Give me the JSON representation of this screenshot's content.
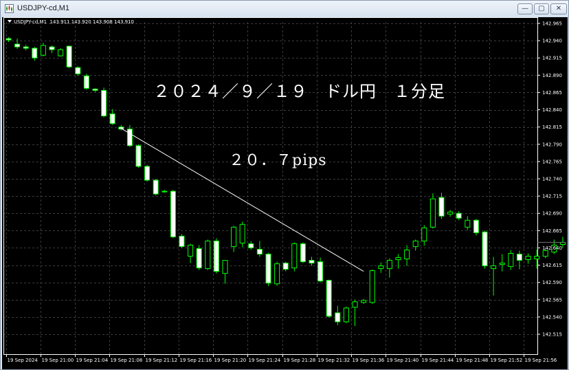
{
  "window": {
    "title": "USDJPY-cd,M1",
    "buttons": {
      "minimize": "—",
      "maximize": "▢",
      "close": "✕"
    }
  },
  "chart_header": {
    "symbol": "USDJPY-cd,M1",
    "ohlc": "143.911 143.920 143.908 143.910"
  },
  "annotations": {
    "title": "２０２４／９／１９　ドル円　１分足",
    "pips": "２０．７pips"
  },
  "colors": {
    "background": "#000000",
    "grid": "#3c3c3c",
    "bull": "#00ff00",
    "bear_body": "#ffffff",
    "bear_wick": "#00ff00",
    "text": "#ffffff",
    "trendline": "#ffffff"
  },
  "chart_data": {
    "type": "candlestick",
    "symbol": "USDJPY-cd",
    "timeframe": "M1",
    "y_axis": {
      "ticks": [
        142.965,
        142.94,
        142.915,
        142.89,
        142.865,
        142.84,
        142.815,
        142.79,
        142.765,
        142.74,
        142.715,
        142.69,
        142.665,
        142.64,
        142.615,
        142.59,
        142.565,
        142.54,
        142.515
      ],
      "tick_labels": [
        "142.965",
        "142.940",
        "142.915",
        "142.890",
        "142.865",
        "142.840",
        "142.815",
        "142.790",
        "142.765",
        "142.740",
        "142.715",
        "142.690",
        "142.665",
        "142.640",
        "142.615",
        "142.590",
        "142.565",
        "142.540",
        "142.515"
      ]
    },
    "x_axis": {
      "labels": [
        "19 Sep 2024",
        "19 Sep 21:00",
        "19 Sep 21:04",
        "19 Sep 21:08",
        "19 Sep 21:12",
        "19 Sep 21:16",
        "19 Sep 21:20",
        "19 Sep 21:24",
        "19 Sep 21:28",
        "19 Sep 21:32",
        "19 Sep 21:36",
        "19 Sep 21:40",
        "19 Sep 21:44",
        "19 Sep 21:48",
        "19 Sep 21:52",
        "19 Sep 21:56"
      ]
    },
    "grid": true,
    "candles": [
      {
        "o": 142.943,
        "h": 142.945,
        "l": 142.938,
        "c": 142.941
      },
      {
        "o": 142.935,
        "h": 142.943,
        "l": 142.928,
        "c": 142.931
      },
      {
        "o": 142.931,
        "h": 142.934,
        "l": 142.926,
        "c": 142.929
      },
      {
        "o": 142.929,
        "h": 142.931,
        "l": 142.911,
        "c": 142.915
      },
      {
        "o": 142.919,
        "h": 142.937,
        "l": 142.917,
        "c": 142.933
      },
      {
        "o": 142.931,
        "h": 142.933,
        "l": 142.922,
        "c": 142.927
      },
      {
        "o": 142.918,
        "h": 142.929,
        "l": 142.917,
        "c": 142.927
      },
      {
        "o": 142.932,
        "h": 142.933,
        "l": 142.9,
        "c": 142.902
      },
      {
        "o": 142.901,
        "h": 142.903,
        "l": 142.889,
        "c": 142.892
      },
      {
        "o": 142.889,
        "h": 142.892,
        "l": 142.869,
        "c": 142.871
      },
      {
        "o": 142.87,
        "h": 142.871,
        "l": 142.866,
        "c": 142.868
      },
      {
        "o": 142.868,
        "h": 142.872,
        "l": 142.829,
        "c": 142.831
      },
      {
        "o": 142.834,
        "h": 142.841,
        "l": 142.818,
        "c": 142.82
      },
      {
        "o": 142.815,
        "h": 142.818,
        "l": 142.81,
        "c": 142.812
      },
      {
        "o": 142.812,
        "h": 142.818,
        "l": 142.786,
        "c": 142.788
      },
      {
        "o": 142.788,
        "h": 142.79,
        "l": 142.756,
        "c": 142.758
      },
      {
        "o": 142.758,
        "h": 142.76,
        "l": 142.736,
        "c": 142.738
      },
      {
        "o": 142.738,
        "h": 142.74,
        "l": 142.716,
        "c": 142.718
      },
      {
        "o": 142.722,
        "h": 142.724,
        "l": 142.72,
        "c": 142.722
      },
      {
        "o": 142.722,
        "h": 142.724,
        "l": 142.654,
        "c": 142.656
      },
      {
        "o": 142.657,
        "h": 142.66,
        "l": 142.64,
        "c": 142.642
      },
      {
        "o": 142.628,
        "h": 142.646,
        "l": 142.618,
        "c": 142.644
      },
      {
        "o": 142.639,
        "h": 142.644,
        "l": 142.608,
        "c": 142.611
      },
      {
        "o": 142.61,
        "h": 142.652,
        "l": 142.608,
        "c": 142.65
      },
      {
        "o": 142.65,
        "h": 142.654,
        "l": 142.603,
        "c": 142.606
      },
      {
        "o": 142.603,
        "h": 142.62,
        "l": 142.588,
        "c": 142.622
      },
      {
        "o": 142.642,
        "h": 142.672,
        "l": 142.634,
        "c": 142.67
      },
      {
        "o": 142.647,
        "h": 142.678,
        "l": 142.641,
        "c": 142.674
      },
      {
        "o": 142.646,
        "h": 142.65,
        "l": 142.637,
        "c": 142.64
      },
      {
        "o": 142.638,
        "h": 142.65,
        "l": 142.627,
        "c": 142.631
      },
      {
        "o": 142.631,
        "h": 142.633,
        "l": 142.585,
        "c": 142.589
      },
      {
        "o": 142.588,
        "h": 142.62,
        "l": 142.585,
        "c": 142.617
      },
      {
        "o": 142.618,
        "h": 142.62,
        "l": 142.606,
        "c": 142.609
      },
      {
        "o": 142.611,
        "h": 142.648,
        "l": 142.606,
        "c": 142.646
      },
      {
        "o": 142.646,
        "h": 142.648,
        "l": 142.618,
        "c": 142.62
      },
      {
        "o": 142.622,
        "h": 142.627,
        "l": 142.614,
        "c": 142.618
      },
      {
        "o": 142.62,
        "h": 142.626,
        "l": 142.59,
        "c": 142.592
      },
      {
        "o": 142.593,
        "h": 142.594,
        "l": 142.539,
        "c": 142.541
      },
      {
        "o": 142.546,
        "h": 142.556,
        "l": 142.528,
        "c": 142.533
      },
      {
        "o": 142.533,
        "h": 142.555,
        "l": 142.531,
        "c": 142.553
      },
      {
        "o": 142.554,
        "h": 142.565,
        "l": 142.527,
        "c": 142.562
      },
      {
        "o": 142.561,
        "h": 142.566,
        "l": 142.559,
        "c": 142.564
      },
      {
        "o": 142.561,
        "h": 142.609,
        "l": 142.559,
        "c": 142.607
      },
      {
        "o": 142.61,
        "h": 142.619,
        "l": 142.604,
        "c": 142.614
      },
      {
        "o": 142.61,
        "h": 142.625,
        "l": 142.597,
        "c": 142.622
      },
      {
        "o": 142.623,
        "h": 142.631,
        "l": 142.61,
        "c": 142.626
      },
      {
        "o": 142.624,
        "h": 142.644,
        "l": 142.614,
        "c": 142.637
      },
      {
        "o": 142.642,
        "h": 142.652,
        "l": 142.636,
        "c": 142.65
      },
      {
        "o": 142.65,
        "h": 142.673,
        "l": 142.643,
        "c": 142.669
      },
      {
        "o": 142.67,
        "h": 142.719,
        "l": 142.668,
        "c": 142.711
      },
      {
        "o": 142.713,
        "h": 142.72,
        "l": 142.682,
        "c": 142.686
      },
      {
        "o": 142.689,
        "h": 142.695,
        "l": 142.685,
        "c": 142.692
      },
      {
        "o": 142.69,
        "h": 142.693,
        "l": 142.68,
        "c": 142.683
      },
      {
        "o": 142.67,
        "h": 142.686,
        "l": 142.666,
        "c": 142.68
      },
      {
        "o": 142.68,
        "h": 142.682,
        "l": 142.658,
        "c": 142.662
      },
      {
        "o": 142.663,
        "h": 142.665,
        "l": 142.61,
        "c": 142.614
      },
      {
        "o": 142.61,
        "h": 142.627,
        "l": 142.571,
        "c": 142.614
      },
      {
        "o": 142.616,
        "h": 142.631,
        "l": 142.606,
        "c": 142.618
      },
      {
        "o": 142.613,
        "h": 142.637,
        "l": 142.608,
        "c": 142.632
      },
      {
        "o": 142.631,
        "h": 142.636,
        "l": 142.609,
        "c": 142.622
      },
      {
        "o": 142.623,
        "h": 142.632,
        "l": 142.617,
        "c": 142.628
      },
      {
        "o": 142.624,
        "h": 142.638,
        "l": 142.61,
        "c": 142.628
      },
      {
        "o": 142.628,
        "h": 142.639,
        "l": 142.625,
        "c": 142.636
      },
      {
        "o": 142.634,
        "h": 142.652,
        "l": 142.631,
        "c": 142.644
      },
      {
        "o": 142.645,
        "h": 142.656,
        "l": 142.64,
        "c": 142.648
      }
    ],
    "trendline": {
      "from": {
        "candle": 13,
        "price": 142.813
      },
      "to": {
        "candle": 41,
        "price": 142.606
      }
    }
  }
}
